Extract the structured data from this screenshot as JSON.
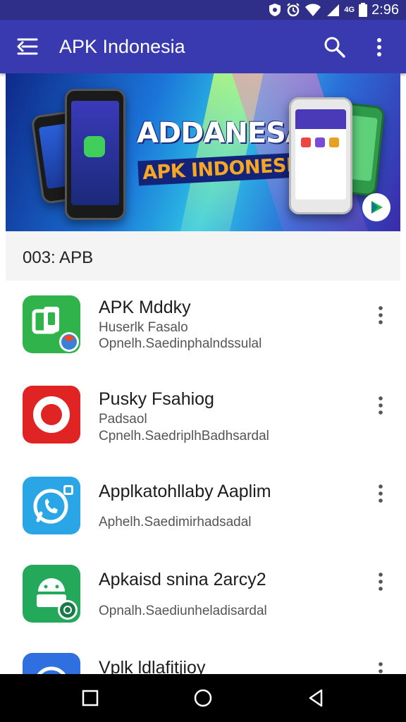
{
  "status_bar": {
    "icons": [
      "shield-icon",
      "alarm-icon",
      "wifi-icon",
      "signal-icon",
      "battery-icon"
    ],
    "network_label": "4G",
    "time": "2:96"
  },
  "app_bar": {
    "title": "APK Indonesia",
    "color": "#3a3ab0"
  },
  "banner": {
    "headline": "ADDANESAN",
    "subheadline": "APK INDONESIA"
  },
  "section": {
    "title": "003: APB"
  },
  "apps": [
    {
      "name": "APK Mddky",
      "line1": "Huserlk Fasalo",
      "line2": "Opnelh.Saedinphalndssulal",
      "icon": "app-green-chat-icon",
      "color": "#2fb34a"
    },
    {
      "name": "Pusky Fsahiog",
      "line1": "Padsaol",
      "line2": "Cpnelh.SaedriplhBadhsardal",
      "icon": "app-red-record-icon",
      "color": "#e02424"
    },
    {
      "name": "Applkatohllaby Aaplim",
      "line1": "Aphelh.Saedimirhadsadal",
      "line2": "",
      "icon": "app-blue-phone-icon",
      "color": "#2aa6e6"
    },
    {
      "name": "Apkaisd  snina 2arcy2",
      "line1": "Opnalh.Saediunheladisardal",
      "line2": "",
      "icon": "app-green-android-icon",
      "color": "#24a85a"
    },
    {
      "name": "Vplk ldlafitjioy",
      "line1": "",
      "line2": "",
      "icon": "app-blue-partial-icon",
      "color": "#2f6fe0"
    }
  ],
  "nav_bar": {
    "buttons": [
      "recents-button",
      "home-button",
      "back-button"
    ]
  }
}
